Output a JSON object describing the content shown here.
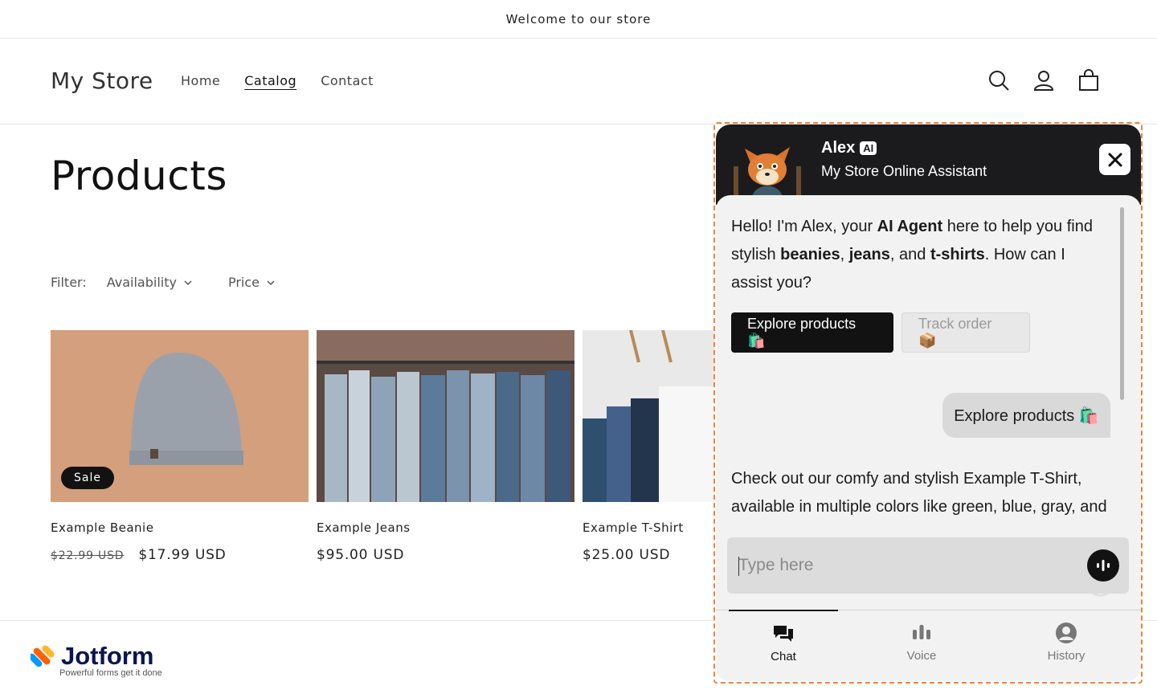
{
  "announcement": "Welcome to our store",
  "header": {
    "logo": "My Store",
    "nav": [
      "Home",
      "Catalog",
      "Contact"
    ]
  },
  "page": {
    "title": "Products",
    "filter_label": "Filter:",
    "filters": [
      "Availability",
      "Price"
    ]
  },
  "products": [
    {
      "name": "Example Beanie",
      "old_price": "$22.99 USD",
      "price": "$17.99 USD",
      "badge": "Sale"
    },
    {
      "name": "Example Jeans",
      "price": "$95.00 USD"
    },
    {
      "name": "Example T-Shirt",
      "price": "$25.00 USD"
    }
  ],
  "footer": {
    "brand": "Jotform",
    "tagline": "Powerful forms get it done"
  },
  "chat": {
    "agent_name": "Alex",
    "ai_badge": "AI",
    "subtitle": "My Store Online Assistant",
    "message1": {
      "t1": "Hello! I'm Alex, your ",
      "b1": "AI Agent",
      "t2": " here to help you find stylish ",
      "b2": "beanies",
      "t3": ", ",
      "b3": "jeans",
      "t4": ", and ",
      "b4": "t-shirts",
      "t5": ". How can I assist you?"
    },
    "quick_replies": [
      "Explore products 🛍️",
      "Track order 📦"
    ],
    "user_message": "Explore products 🛍️",
    "message2": "Check out our comfy and stylish Example T-Shirt, available in multiple colors like green, blue, gray, and",
    "input_placeholder": "Type here",
    "tabs": [
      "Chat",
      "Voice",
      "History"
    ]
  },
  "colors": {
    "accent_dark": "#121212",
    "frame_outline": "#f08234",
    "chat_header": "#1b1b1d"
  }
}
